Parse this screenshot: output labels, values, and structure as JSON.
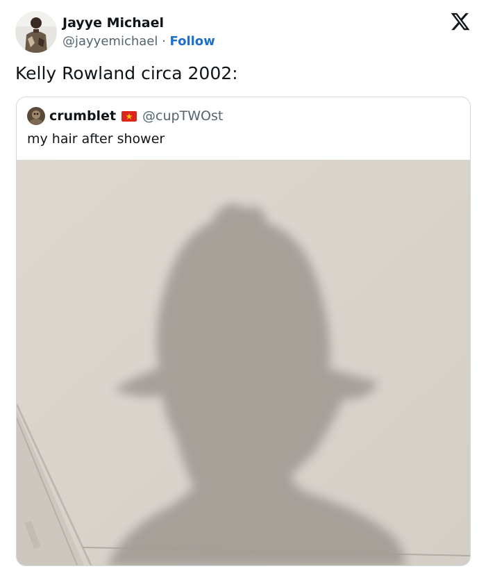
{
  "author": {
    "display_name": "Jayye Michael",
    "handle": "@jayyemichael",
    "separator": " · ",
    "follow_label": "Follow"
  },
  "tweet": {
    "text": "Kelly Rowland circa 2002:"
  },
  "quoted": {
    "display_name": "crumblet",
    "handle": "@cupTWOst",
    "text": "my hair after shower"
  },
  "icons": {
    "brand": "x-logo-icon",
    "flag": "vietnam-flag-icon"
  },
  "colors": {
    "link": "#1d70c8",
    "secondary_text": "#536471",
    "border": "#cfd9de",
    "wall": "#d9d4cc",
    "shadow": "#9a958d",
    "flag_red": "#da251d",
    "flag_star": "#ffcd00"
  }
}
